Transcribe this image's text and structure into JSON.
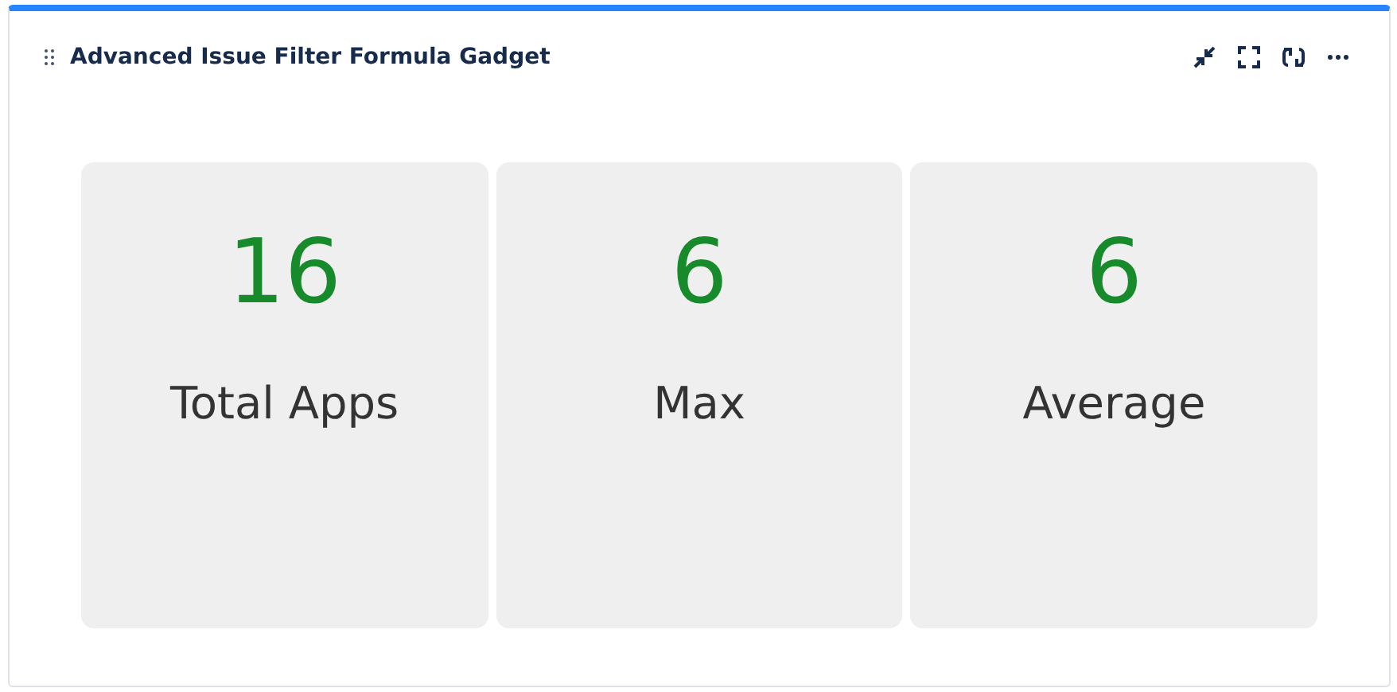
{
  "gadget": {
    "title": "Advanced Issue Filter Formula Gadget"
  },
  "stats": [
    {
      "value": "16",
      "label": "Total Apps"
    },
    {
      "value": "6",
      "label": "Max"
    },
    {
      "value": "6",
      "label": "Average"
    }
  ]
}
